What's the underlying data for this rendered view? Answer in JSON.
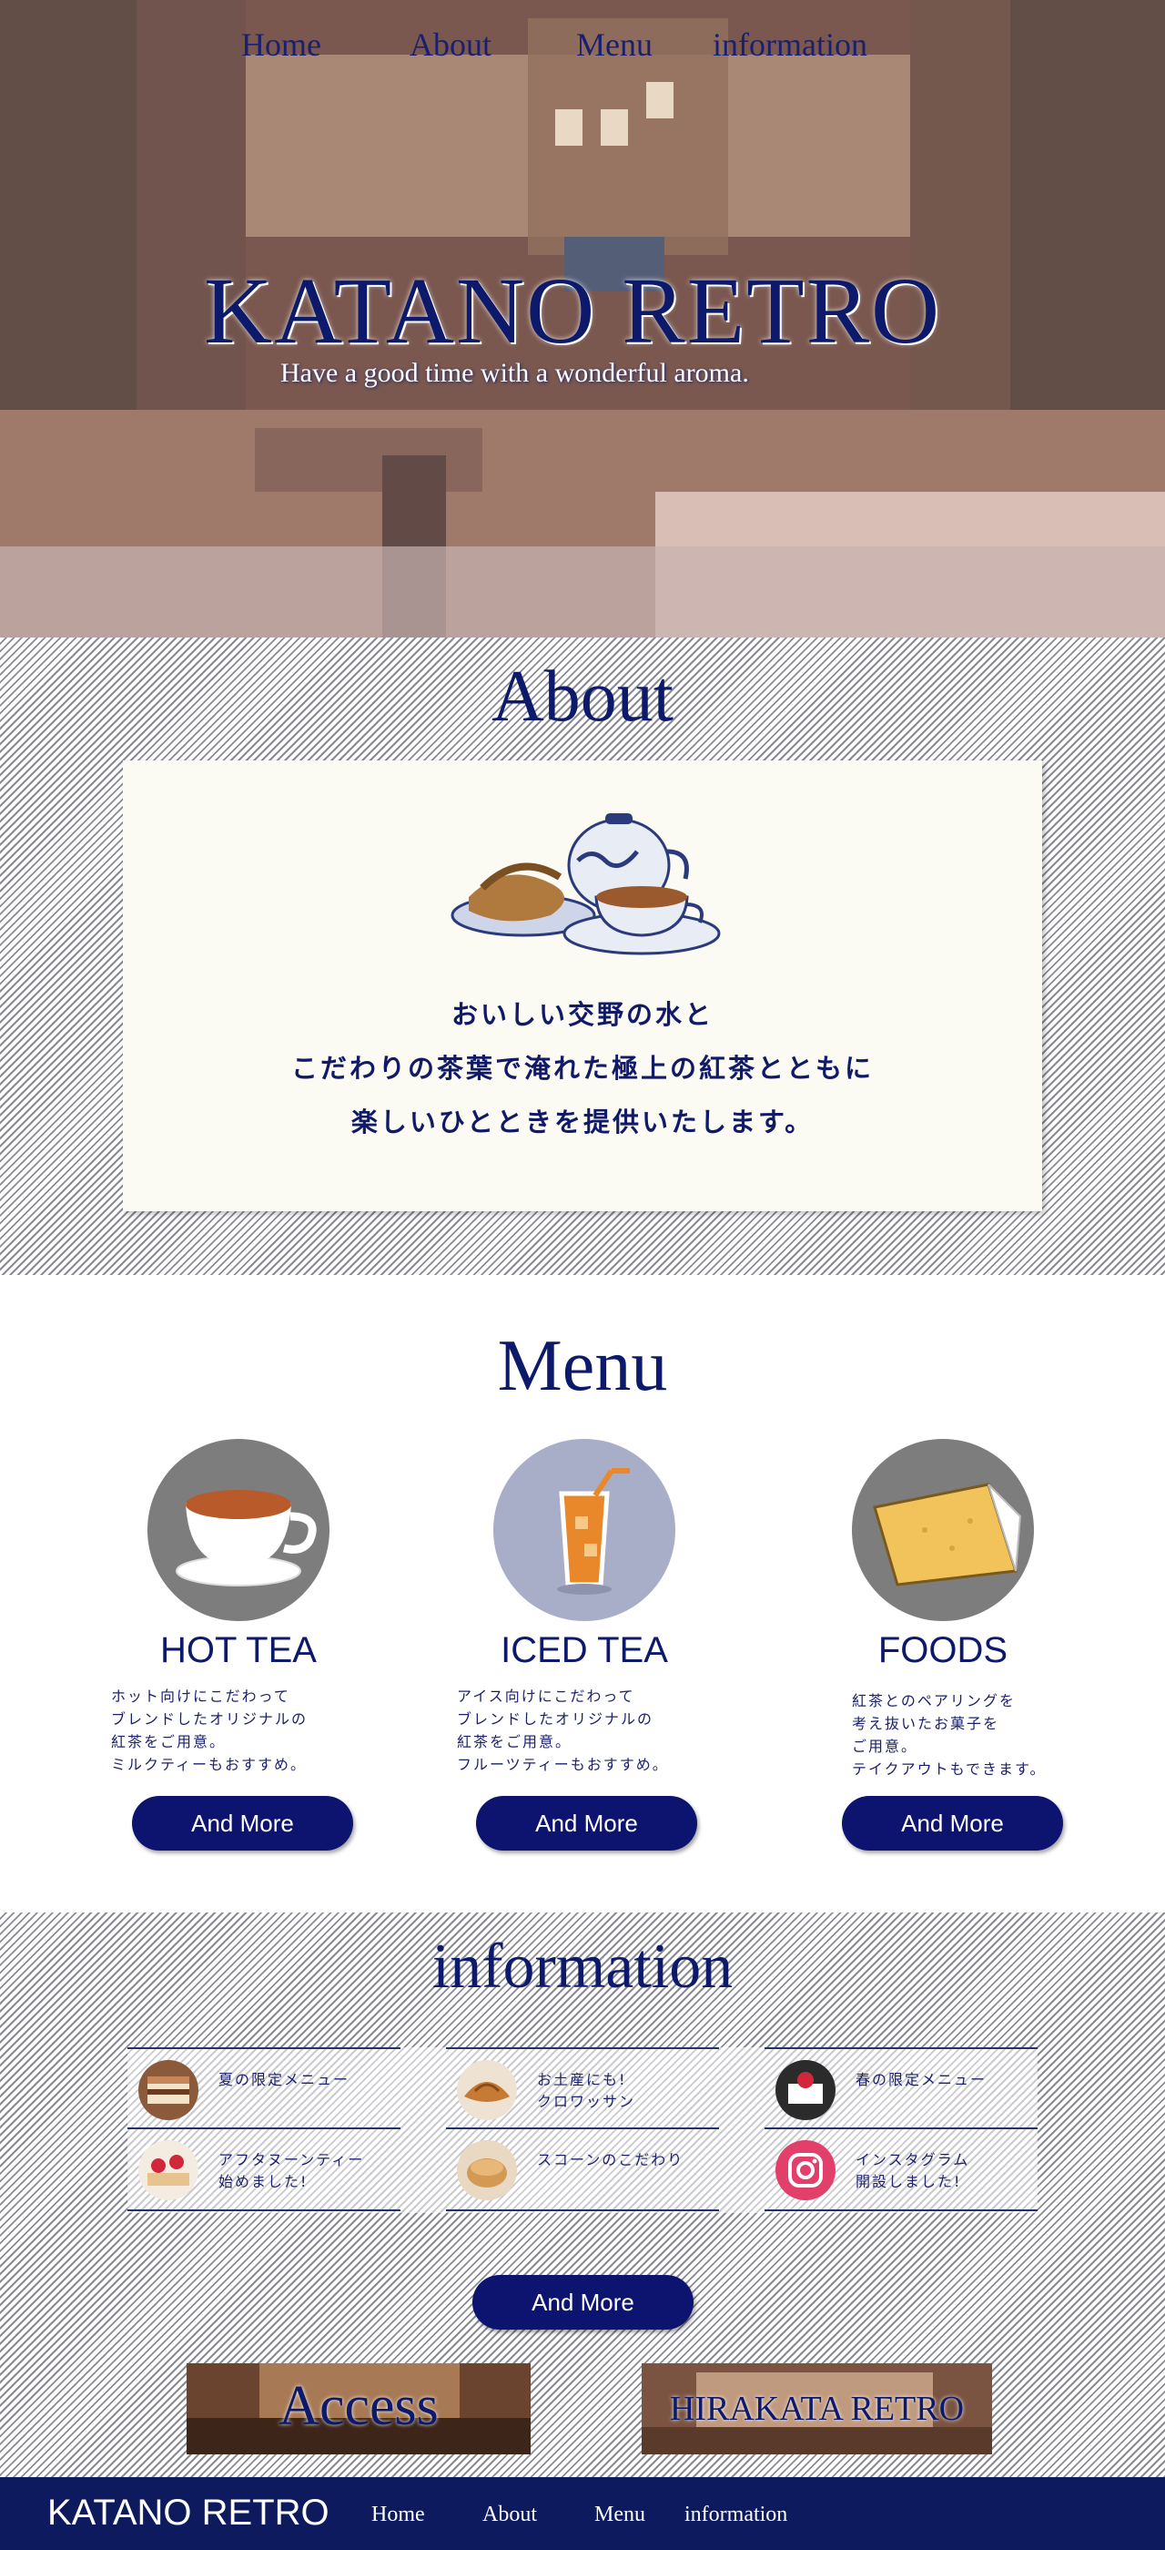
{
  "nav": {
    "items": [
      "Home",
      "About",
      "Menu",
      "information"
    ]
  },
  "hero": {
    "title": "KATANO RETRO",
    "tagline": "Have a good time with a wonderful aroma."
  },
  "about": {
    "title": "About",
    "lines": [
      "おいしい交野の水と",
      "こだわりの茶葉で淹れた極上の紅茶とともに",
      "楽しいひとときを提供いたします。"
    ]
  },
  "menu": {
    "title": "Menu",
    "items": [
      {
        "name": "HOT TEA",
        "desc": "ホット向けにこだわって\nブレンドしたオリジナルの\n紅茶をご用意。\nミルクティーもおすすめ。",
        "button": "And More",
        "icon": "hot-tea-cup-icon"
      },
      {
        "name": "ICED TEA",
        "desc": "アイス向けにこだわって\nブレンドしたオリジナルの\n紅茶をご用意。\nフルーツティーもおすすめ。",
        "button": "And More",
        "icon": "iced-tea-glass-icon"
      },
      {
        "name": "FOODS",
        "desc": "紅茶とのペアリングを\n考え抜いたお菓子を\nご用意。\nテイクアウトもできます。",
        "button": "And More",
        "icon": "chiffon-cake-icon"
      }
    ]
  },
  "info": {
    "title": "information",
    "items": [
      {
        "text": "夏の限定メニュー"
      },
      {
        "text": "お土産にも!\nクロワッサン"
      },
      {
        "text": "春の限定メニュー"
      },
      {
        "text": "アフタヌーンティー\n始めました!"
      },
      {
        "text": "スコーンのこだわり"
      },
      {
        "text": "インスタグラム\n開設しました!"
      }
    ],
    "button": "And More"
  },
  "banners": {
    "access": "Access",
    "hirakata": "HIRAKATA RETRO"
  },
  "footer": {
    "logo": "KATANO RETRO",
    "nav": [
      "Home",
      "About",
      "Menu",
      "information"
    ]
  },
  "colors": {
    "navy": "#0d1a6b",
    "footer": "#0d1a5e",
    "card": "#fbfbf4",
    "circle_gray": "#7d7d7d",
    "circle_blue": "#a9aec8"
  }
}
